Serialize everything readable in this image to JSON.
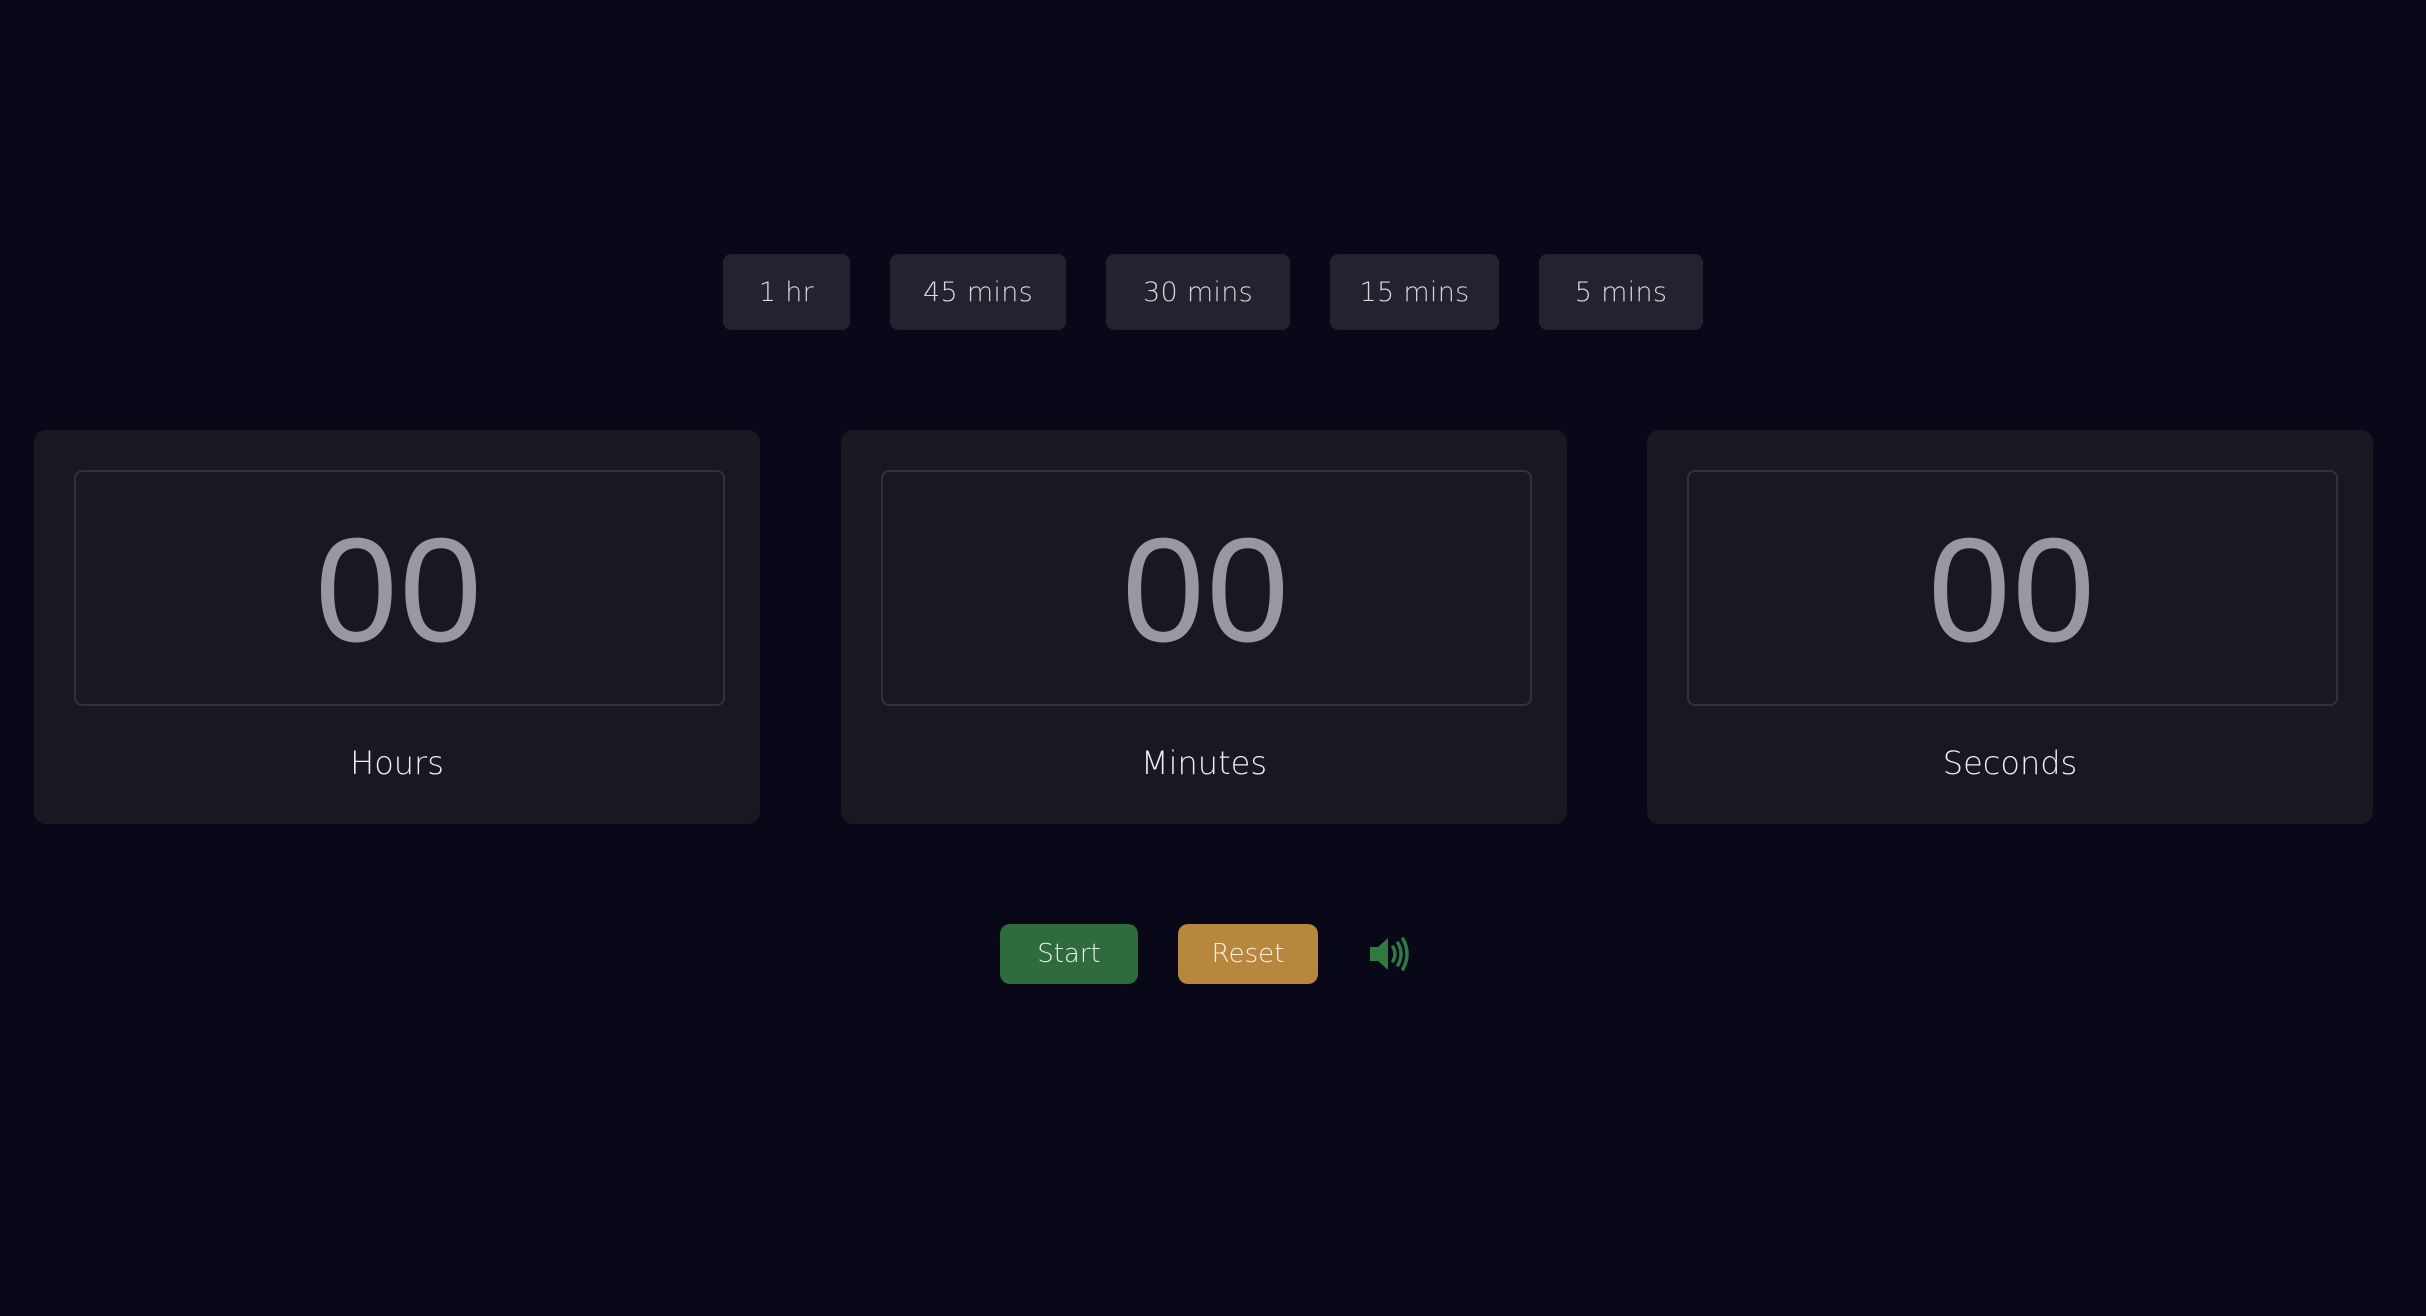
{
  "presets": [
    {
      "label": "1 hr"
    },
    {
      "label": "45 mins"
    },
    {
      "label": "30 mins"
    },
    {
      "label": "15 mins"
    },
    {
      "label": "5 mins"
    }
  ],
  "timer": {
    "hours": {
      "value": "00",
      "label": "Hours"
    },
    "minutes": {
      "value": "00",
      "label": "Minutes"
    },
    "seconds": {
      "value": "00",
      "label": "Seconds"
    }
  },
  "controls": {
    "start_label": "Start",
    "reset_label": "Reset",
    "sound_icon": "speaker-volume-icon"
  },
  "colors": {
    "background": "#080819",
    "panel": "#1a1721",
    "preset": "#23232f",
    "start": "#2f6b3b",
    "reset": "#b8873e",
    "sound_icon": "#2f7a3f"
  }
}
